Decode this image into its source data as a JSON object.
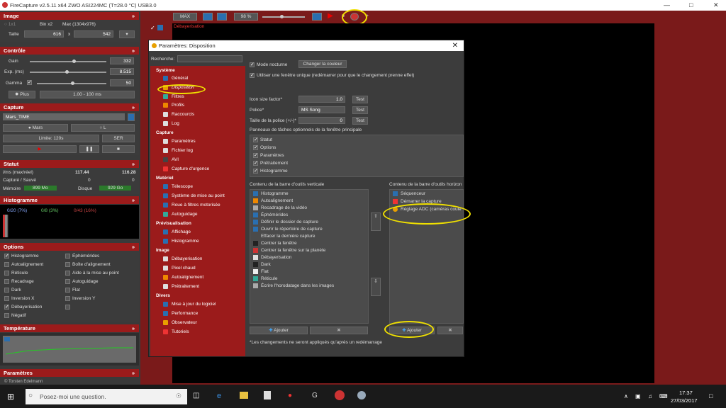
{
  "window": {
    "title": "FireCapture v2.5.11  x64     ZWO ASI224MC (T=28.0 °C) USB3.0"
  },
  "image": {
    "header": "Image",
    "bin": "Bin x2",
    "max": "Max (1304x976)",
    "taille_label": "Taille",
    "w": "616",
    "x": "x",
    "h": "542"
  },
  "controle": {
    "header": "Contrôle",
    "gain_label": "Gain",
    "gain": "332",
    "exp_label": "Exp. (ms)",
    "exp": "8.515",
    "gamma_label": "Gamma",
    "gamma": "50",
    "plus": "Plus",
    "range": "1.00 - 100 ms"
  },
  "capture": {
    "header": "Capture",
    "name": "Mars_TIME",
    "obj": "Mars",
    "l": "L",
    "limit": "Limite: 120s",
    "ser": "SER"
  },
  "statut": {
    "header": "Statut",
    "fps_label": "i/ms (max/réel)",
    "fps1": "117.44",
    "fps2": "116.28",
    "saved_label": "Capturé / Sauvé",
    "saved1": "0",
    "saved2": "0",
    "mem_label": "Mémoire",
    "mem": "899 Mo",
    "disk_label": "Disque",
    "disk": "929 Go"
  },
  "histo": {
    "header": "Histogramme",
    "v1": "0/20 (7%)",
    "v2": "0/8 (3%)",
    "v3": "0/43 (16%)"
  },
  "options": {
    "header": "Options",
    "items": [
      "Histogramme",
      "Éphémérides",
      "Autoalignement",
      "Boîte d'alignement",
      "Réticule",
      "Aide à la mise au point",
      "Recadrage",
      "Autoguidage",
      "Dark",
      "Flat",
      "Inversion X",
      "Inversion Y",
      "Débayerisation",
      "",
      "Négatif"
    ]
  },
  "temp": {
    "header": "Température"
  },
  "params": {
    "header": "Paramètres",
    "copy": "© Torsten Edelmann"
  },
  "toolbar": {
    "max": "MAX",
    "pct": "98 %",
    "debayer": "Débayerisation"
  },
  "dialog": {
    "title": "Paramètres: Disposition",
    "search": "Recherche:",
    "tree": [
      {
        "cat": "Système",
        "items": [
          "Général",
          "Disposition",
          "Filtres",
          "Profils",
          "Raccourcis",
          "Log"
        ]
      },
      {
        "cat": "Capture",
        "items": [
          "Paramètres",
          "Fichier log",
          "AVI",
          "Capture d'urgence"
        ]
      },
      {
        "cat": "Matériel",
        "items": [
          "Télescope",
          "Système de mise au point",
          "Roue à filtres motorisée",
          "Autoguidage"
        ]
      },
      {
        "cat": "Prévisualisation",
        "items": [
          "Affichage",
          "Histogramme"
        ]
      },
      {
        "cat": "Image",
        "items": [
          "Débayerisation",
          "Pixel chaud",
          "Autoalignement",
          "Prétraitement"
        ]
      },
      {
        "cat": "Divers",
        "items": [
          "Mise à jour du logiciel",
          "Performance",
          "Observateur",
          "Tutoriels"
        ]
      }
    ],
    "night": "Mode nocturne",
    "change_color": "Changer la couleur",
    "single": "Utiliser une fenêtre unique (redémarrer pour que le changement prenne effet)",
    "icon_size_label": "Icon size factor*",
    "icon_size": "1.0",
    "test": "Test",
    "police_label": "Police*",
    "police": "MS Song",
    "font_size_label": "Taille de la police (+/-)*",
    "font_size": "0",
    "panels_label": "Panneaux de tâches optionnels de la fenêtre principale",
    "panels": [
      "Statut",
      "Options",
      "Paramètres",
      "Prétraitement",
      "Histogramme"
    ],
    "vtool_label": "Contenu de la barre d'outils verticale",
    "vtool": [
      "Histogramme",
      "Autoalignement",
      "Recadrage de la vidéo",
      "Éphémérides",
      "Définir le dossier de capture",
      "Ouvrir le répertoire de capture",
      "Effacer la dernière capture",
      "Centrer la fenêtre",
      "Centrer la fenêtre sur la planète",
      "Débayerisation",
      "Dark",
      "Flat",
      "Réticule",
      "Écrire l'horodatage dans les images"
    ],
    "htool_label": "Contenu de la barre d'outils horizon",
    "htool": [
      "Séquenceur",
      "Démarrer la capture",
      "Réglage ADC (caméras coule"
    ],
    "add": "Ajouter",
    "note": "*Les changements ne seront appliqués qu'après un redémarrage"
  },
  "taskbar": {
    "search": "Posez-moi une question.",
    "time": "17:37",
    "date": "27/03/2017"
  }
}
